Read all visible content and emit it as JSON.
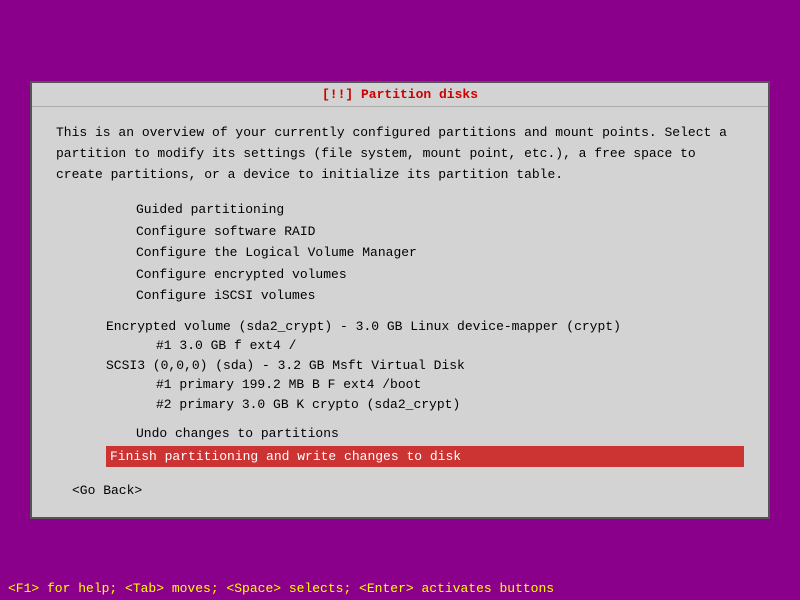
{
  "title": "[!!] Partition disks",
  "description": "This is an overview of your currently configured partitions and mount points. Select a partition to modify its settings (file system, mount point, etc.), a free space to create partitions, or a device to initialize its partition table.",
  "menu_items": [
    "Guided partitioning",
    "Configure software RAID",
    "Configure the Logical Volume Manager",
    "Configure encrypted volumes",
    "Configure iSCSI volumes"
  ],
  "partitions": {
    "encrypted_volume_label": "Encrypted volume (sda2_crypt) - 3.0 GB Linux device-mapper (crypt)",
    "encrypted_volume_sub": "#1          3.0 GB     f  ext4       /",
    "scsi_label": "SCSI3 (0,0,0) (sda) - 3.2 GB Msft Virtual Disk",
    "scsi_primary1": "#1  primary   199.2 MB  B  F  ext4      /boot",
    "scsi_primary2": "#2  primary     3.0 GB     K  crypto    (sda2_crypt)"
  },
  "undo_label": "Undo changes to partitions",
  "finish_label": "Finish partitioning and write changes to disk",
  "go_back_label": "<Go Back>",
  "status_bar": "<F1> for help; <Tab> moves; <Space> selects; <Enter> activates buttons"
}
